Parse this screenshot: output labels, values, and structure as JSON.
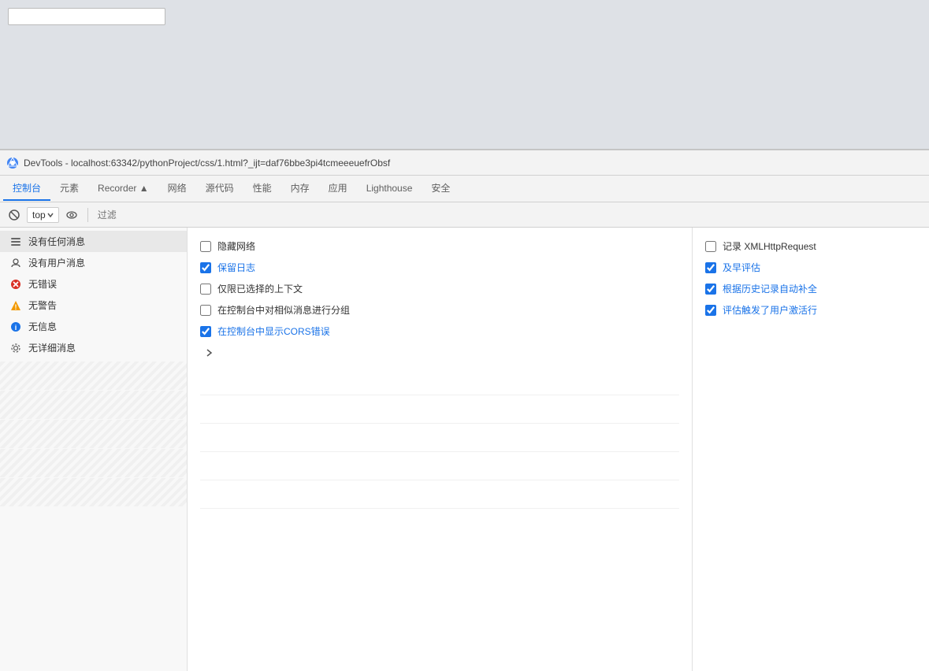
{
  "browser": {
    "address_bar_placeholder": ""
  },
  "devtools": {
    "titlebar": "DevTools - localhost:63342/pythonProject/css/1.html?_ijt=daf76bbe3pi4tcmeeeuefrObsf",
    "tabs": [
      {
        "label": "控制台",
        "active": true
      },
      {
        "label": "元素",
        "active": false
      },
      {
        "label": "Recorder ▲",
        "active": false
      },
      {
        "label": "网络",
        "active": false
      },
      {
        "label": "源代码",
        "active": false
      },
      {
        "label": "性能",
        "active": false
      },
      {
        "label": "内存",
        "active": false
      },
      {
        "label": "应用",
        "active": false
      },
      {
        "label": "Lighthouse",
        "active": false
      },
      {
        "label": "安全",
        "active": false
      }
    ],
    "toolbar": {
      "top_label": "top",
      "filter_placeholder": "过滤"
    },
    "sidebar": {
      "items": [
        {
          "icon": "list",
          "label": "没有任何消息",
          "active": true
        },
        {
          "icon": "user",
          "label": "没有用户消息"
        },
        {
          "icon": "error",
          "label": "无错误"
        },
        {
          "icon": "warning",
          "label": "无警告"
        },
        {
          "icon": "info",
          "label": "无信息"
        },
        {
          "icon": "verbose",
          "label": "无详细消息"
        }
      ]
    },
    "checkboxes_left": [
      {
        "label": "隐藏网络",
        "checked": false
      },
      {
        "label": "保留日志",
        "checked": true
      },
      {
        "label": "仅限已选择的上下文",
        "checked": false
      },
      {
        "label": "在控制台中对相似消息进行分组",
        "checked": false
      },
      {
        "label": "在控制台中显示CORS错误",
        "checked": true
      }
    ],
    "checkboxes_right": [
      {
        "label": "记录 XMLHttpRequest",
        "checked": false
      },
      {
        "label": "及早评估",
        "checked": true
      },
      {
        "label": "根据历史记录自动补全",
        "checked": true
      },
      {
        "label": "评估触发了用户激活行",
        "checked": true
      }
    ]
  }
}
